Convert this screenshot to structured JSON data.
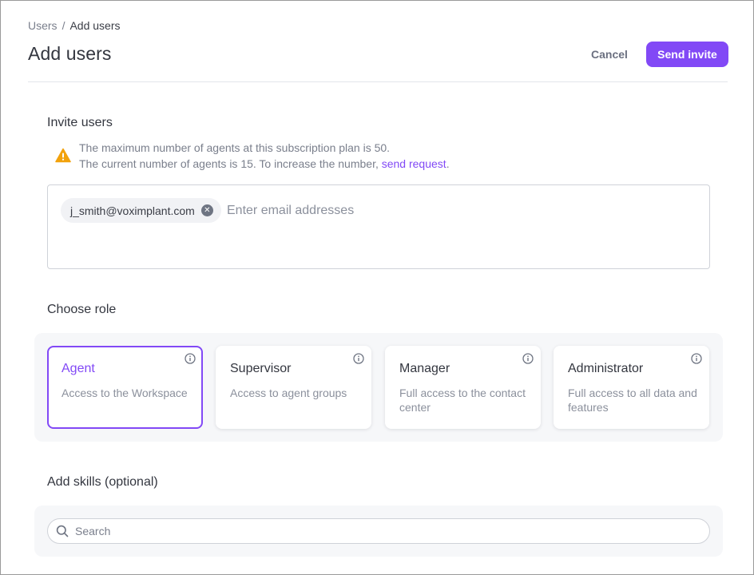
{
  "breadcrumb": {
    "parent": "Users",
    "separator": "/",
    "current": "Add users"
  },
  "header": {
    "title": "Add users",
    "cancel_label": "Cancel",
    "send_label": "Send invite"
  },
  "invite": {
    "heading": "Invite users",
    "warning_line1": "The maximum number of agents at this subscription plan is 50.",
    "warning_line2_prefix": "The current number of agents is 15. To increase the number, ",
    "warning_link": "send request",
    "warning_line2_suffix": ".",
    "chips": [
      "j_smith@voximplant.com"
    ],
    "input_placeholder": "Enter email addresses",
    "input_value": ""
  },
  "roles": {
    "heading": "Choose role",
    "selected": "Agent",
    "cards": [
      {
        "title": "Agent",
        "description": "Access to the Workspace"
      },
      {
        "title": "Supervisor",
        "description": "Access to agent groups"
      },
      {
        "title": "Manager",
        "description": "Full access to the contact center"
      },
      {
        "title": "Administrator",
        "description": "Full access to all data and features"
      }
    ]
  },
  "skills": {
    "heading": "Add skills (optional)",
    "search_placeholder": "Search",
    "search_value": ""
  },
  "icons": {
    "warning": "warning-triangle-icon",
    "chip_remove": "close-circle-icon",
    "info": "info-circle-icon",
    "search": "search-icon"
  },
  "colors": {
    "accent": "#8249f6",
    "warning": "#f2a20c",
    "muted_text": "#7a7f8c",
    "panel_bg": "#f6f7f9"
  }
}
